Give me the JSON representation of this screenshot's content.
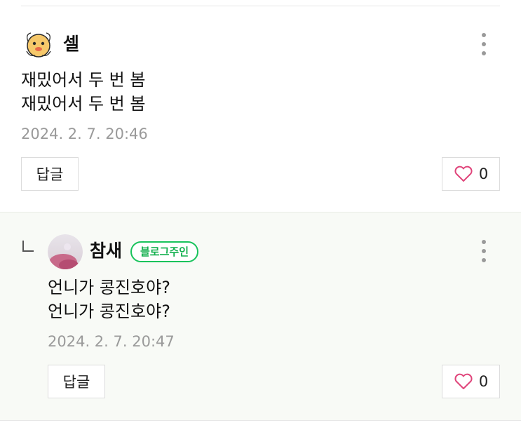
{
  "comments": [
    {
      "author": "셀",
      "avatar_icon": "character-face-icon",
      "lines": [
        "재밌어서 두 번 봄",
        "재밌어서 두 번 봄"
      ],
      "timestamp": "2024. 2. 7. 20:46",
      "reply_label": "답글",
      "like_count": "0"
    },
    {
      "author": "참새",
      "badge": "블로그주인",
      "avatar_icon": "profile-photo",
      "lines": [
        "언니가 콩진호야?",
        "언니가 콩진호야?"
      ],
      "timestamp": "2024. 2. 7. 20:47",
      "reply_label": "답글",
      "like_count": "0"
    }
  ],
  "colors": {
    "badge_green": "#19c35c",
    "heart_pink": "#e0457b",
    "reply_background": "#f8faf6"
  }
}
